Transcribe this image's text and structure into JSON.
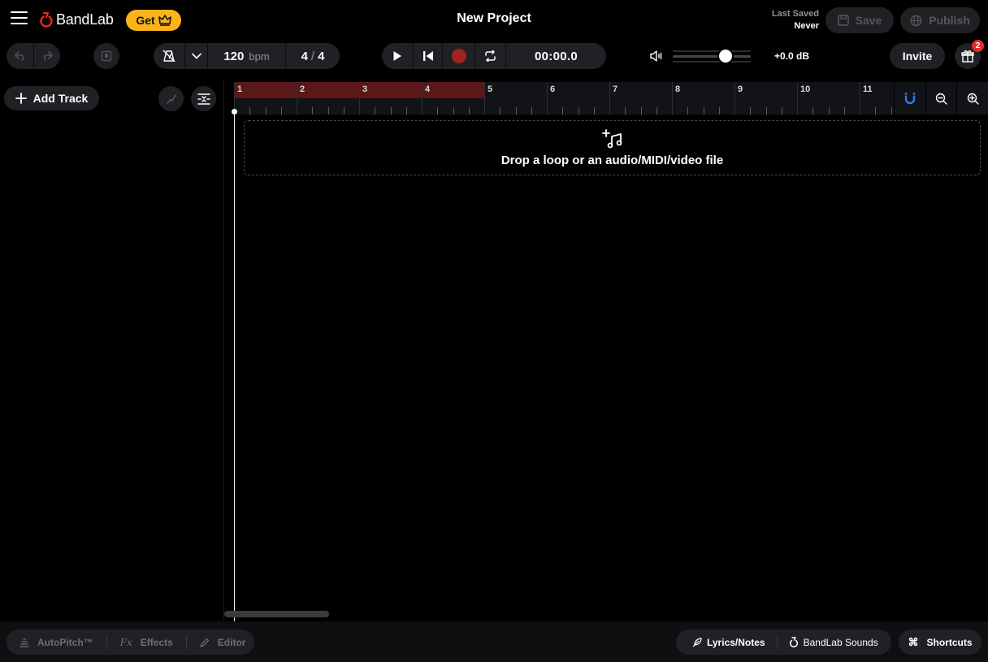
{
  "header": {
    "brand": "BandLab",
    "get_label": "Get",
    "project_title": "New Project",
    "last_saved_label": "Last Saved",
    "last_saved_value": "Never",
    "save_label": "Save",
    "publish_label": "Publish"
  },
  "transport": {
    "bpm_value": "120",
    "bpm_unit": "bpm",
    "time_sig_top": "4",
    "time_sig_bottom": "4",
    "time_display": "00:00.0",
    "volume_db": "+0.0 dB",
    "invite_label": "Invite",
    "gift_badge": "2"
  },
  "tracks": {
    "add_track_label": "Add Track"
  },
  "timeline": {
    "bars": [
      "1",
      "2",
      "3",
      "4",
      "5",
      "6",
      "7",
      "8",
      "9",
      "10",
      "11"
    ],
    "loop_bars": 4,
    "drop_text": "Drop a loop or an audio/MIDI/video file"
  },
  "bottom": {
    "autopitch_label": "AutoPitch™",
    "effects_label": "Effects",
    "editor_label": "Editor",
    "lyrics_label": "Lyrics/Notes",
    "sounds_label": "BandLab Sounds",
    "shortcuts_label": "Shortcuts"
  },
  "colors": {
    "brand_red": "#f0261d",
    "get_yellow": "#fbb31a",
    "loop_region": "#5a1818",
    "record": "#a0251c",
    "magnet_blue": "#2e7bf0"
  }
}
